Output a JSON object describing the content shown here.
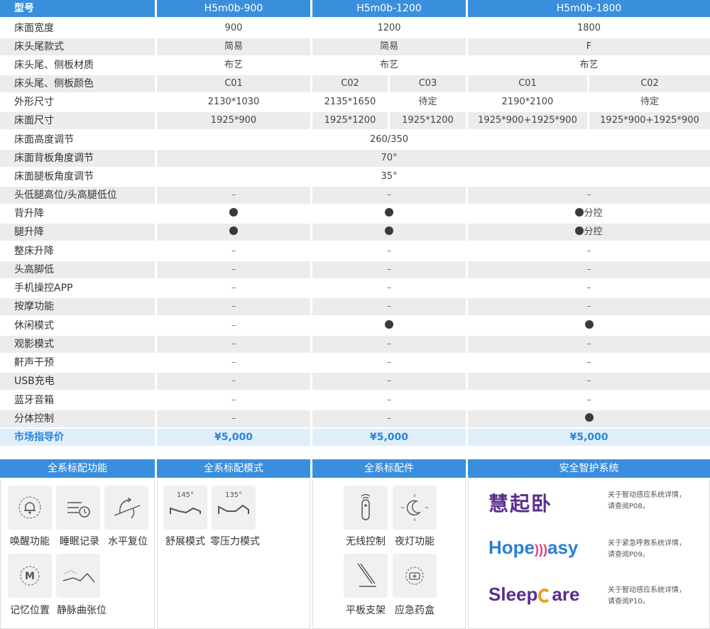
{
  "columns": [
    "H5m0b-900",
    "H5m0b-1200",
    "H5m0b-1800"
  ],
  "header_label": "型号",
  "rows": {
    "r1": {
      "label": "床面宽度",
      "a": "900",
      "b": "1200",
      "c": "1800"
    },
    "r2": {
      "label": "床头尾款式",
      "a": "简易",
      "b": "简易",
      "c": "F"
    },
    "r3": {
      "label": "床头尾、侧板材质",
      "a": "布艺",
      "b": "布艺",
      "c": "布艺"
    },
    "r4": {
      "label": "床头尾、侧板颜色",
      "a": "C01",
      "b1": "C02",
      "b2": "C03",
      "c1": "C01",
      "c2": "C02"
    },
    "r5": {
      "label": "外形尺寸",
      "a": "2130*1030",
      "b1": "2135*1650",
      "b2": "待定",
      "c1": "2190*2100",
      "c2": "待定"
    },
    "r6": {
      "label": "床面尺寸",
      "a": "1925*900",
      "b1": "1925*1200",
      "b2": "1925*1200",
      "c1": "1925*900+1925*900",
      "c2": "1925*900+1925*900"
    },
    "r7": {
      "label": "床面高度调节",
      "all": "260/350"
    },
    "r8": {
      "label": "床面背板角度调节",
      "all": "70°"
    },
    "r9": {
      "label": "床面腿板角度调节",
      "all": "35°"
    },
    "r10": {
      "label": "头低腿高位/头高腿低位",
      "a": "–",
      "b": "–",
      "c": "–"
    },
    "r11": {
      "label": "背升降",
      "c_text": "分控"
    },
    "r12": {
      "label": "腿升降",
      "c_text": "分控"
    },
    "r13": {
      "label": "整床升降",
      "a": "–",
      "b": "–",
      "c": "–"
    },
    "r14": {
      "label": "头高脚低",
      "a": "–",
      "b": "–",
      "c": "–"
    },
    "r15": {
      "label": "手机操控APP",
      "a": "–",
      "b": "–",
      "c": "–"
    },
    "r16": {
      "label": "按摩功能",
      "a": "–",
      "b": "–",
      "c": "–"
    },
    "r17": {
      "label": "休闲模式",
      "a": "–"
    },
    "r18": {
      "label": "观影模式",
      "a": "–",
      "b": "–",
      "c": "–"
    },
    "r19": {
      "label": "鼾声干预",
      "a": "–",
      "b": "–",
      "c": "–"
    },
    "r20": {
      "label": "USB充电",
      "a": "–",
      "b": "–",
      "c": "–"
    },
    "r21": {
      "label": "蓝牙音箱",
      "a": "–",
      "b": "–",
      "c": "–"
    },
    "r22": {
      "label": "分体控制",
      "a": "–",
      "b": "–"
    },
    "price": {
      "label": "市场指导价",
      "a": "¥5,000",
      "b": "¥5,000",
      "c": "¥5,000"
    }
  },
  "sections": {
    "functions": {
      "title": "全系标配功能",
      "items": [
        "唤醒功能",
        "睡眠记录",
        "水平复位",
        "记忆位置",
        "静脉曲张位"
      ],
      "m_glyph": "M"
    },
    "modes": {
      "title": "全系标配模式",
      "items": [
        "舒展模式",
        "零压力模式"
      ],
      "angles": [
        "145°",
        "135°"
      ]
    },
    "accessories": {
      "title": "全系标配件",
      "items": [
        "无线控制",
        "夜灯功能",
        "平板支架",
        "应急药盒"
      ]
    },
    "safety": {
      "title": "安全智护系统",
      "brand1": "慧起卧",
      "brand2_a": "Hope",
      "brand2_b": "asy",
      "brand3_a": "Sleep",
      "brand3_b": "are",
      "notes": [
        [
          "关于智动感应系统详情，",
          "请查阅P08。"
        ],
        [
          "关于紧急呼救系统详情，",
          "请查阅P09。"
        ],
        [
          "关于智动感应系统详情，",
          "请查阅P10。"
        ]
      ]
    }
  },
  "colors": {
    "accent": "#3a8fdc",
    "price_text": "#2a86d9",
    "shade": "#ececec",
    "brand_pink": "#e23a7a",
    "brand_blue": "#2a7fd4",
    "brand_purple": "#5b2d8e"
  }
}
